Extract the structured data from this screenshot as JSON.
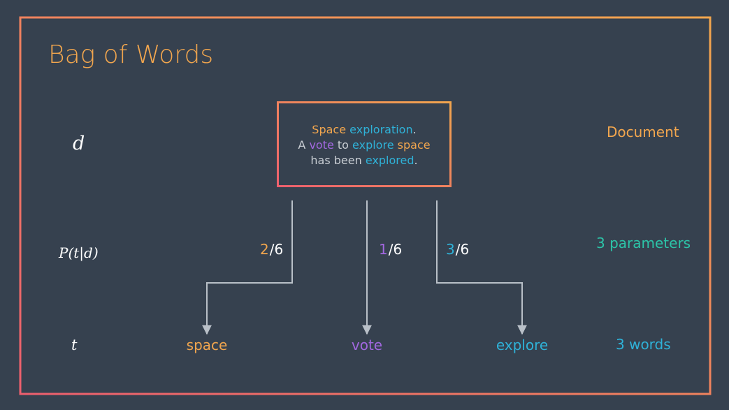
{
  "title": "Bag of Words",
  "math_labels": {
    "document": "d",
    "probability": "P(t|d)",
    "term": "t"
  },
  "right_labels": {
    "document": "Document",
    "parameters": "3 parameters",
    "words": "3 words"
  },
  "document_text": {
    "line1": [
      {
        "text": "Space",
        "color": "orange"
      },
      {
        "text": " ",
        "color": "gray"
      },
      {
        "text": "exploration",
        "color": "blue"
      },
      {
        "text": ".",
        "color": "gray"
      }
    ],
    "line2": [
      {
        "text": "A ",
        "color": "gray"
      },
      {
        "text": "vote",
        "color": "purple"
      },
      {
        "text": " to ",
        "color": "gray"
      },
      {
        "text": "explore",
        "color": "blue"
      },
      {
        "text": " ",
        "color": "gray"
      },
      {
        "text": "space",
        "color": "orange"
      }
    ],
    "line3": [
      {
        "text": "has been ",
        "color": "gray"
      },
      {
        "text": "explored",
        "color": "blue"
      },
      {
        "text": ".",
        "color": "gray"
      }
    ]
  },
  "probabilities": [
    {
      "term": "space",
      "numerator": "2",
      "denominator": "/6"
    },
    {
      "term": "vote",
      "numerator": "1",
      "denominator": "/6"
    },
    {
      "term": "explore",
      "numerator": "3",
      "denominator": "/6"
    }
  ],
  "words": [
    "space",
    "vote",
    "explore"
  ],
  "colors": {
    "background": "#36414f",
    "orange": "#f2a64e",
    "coral": "#ee5f6e",
    "blue": "#2fb2d8",
    "purple": "#a268e0",
    "teal": "#2cc4a8",
    "gray": "#c8cdd3",
    "arrow": "#b9c0c8"
  }
}
